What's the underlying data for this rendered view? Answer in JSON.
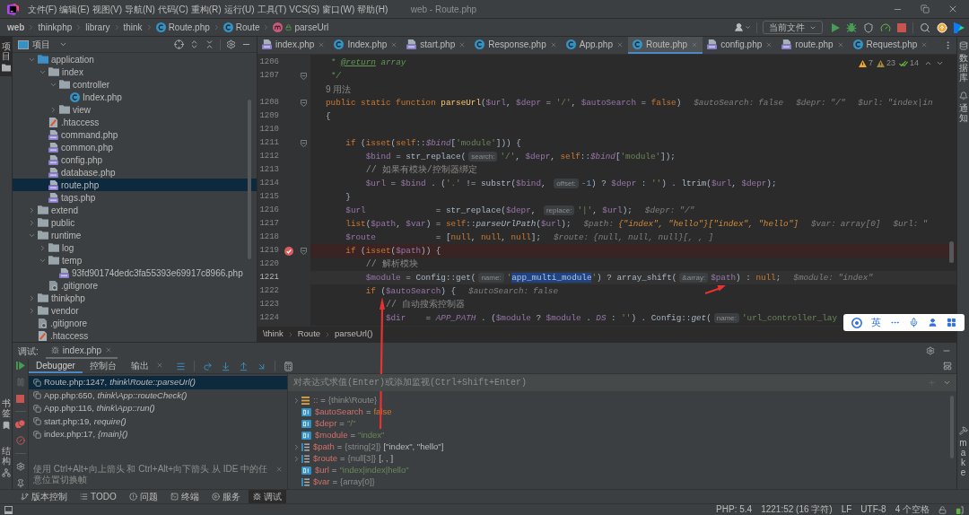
{
  "title_bar": {
    "menu": [
      "文件(F)",
      "编辑(E)",
      "视图(V)",
      "导航(N)",
      "代码(C)",
      "重构(R)",
      "运行(U)",
      "工具(T)",
      "VCS(S)",
      "窗口(W)",
      "帮助(H)"
    ],
    "title": "web - Route.php"
  },
  "nav_bar": {
    "breadcrumbs": [
      {
        "label": "web",
        "kind": "project"
      },
      {
        "label": "thinkphp",
        "kind": "folder"
      },
      {
        "label": "library",
        "kind": "folder"
      },
      {
        "label": "think",
        "kind": "folder"
      },
      {
        "label": "Route.php",
        "kind": "class"
      },
      {
        "label": "Route",
        "kind": "class"
      },
      {
        "label": "parseUrl",
        "kind": "method"
      }
    ],
    "run_configuration": "当前文件"
  },
  "left_stripe": {
    "top": [
      {
        "label": "项目",
        "kind": "project",
        "selected": true
      }
    ],
    "bottom": [
      {
        "label": "书签",
        "kind": "bookmarks",
        "selected": false
      },
      {
        "label": "结构",
        "kind": "structure",
        "selected": false
      }
    ]
  },
  "right_stripe": {
    "top": [
      {
        "label": "数据库",
        "kind": "database",
        "selected": false
      },
      {
        "label": "通知",
        "kind": "notifications",
        "selected": false
      }
    ],
    "bottom": [
      {
        "label": "make",
        "kind": "make",
        "selected": false
      }
    ]
  },
  "project": {
    "title": "项目",
    "tree": [
      {
        "label": "application",
        "kind": "source_folder",
        "expanded": true,
        "selected": false,
        "children": [
          {
            "label": "index",
            "kind": "folder",
            "expanded": true,
            "selected": false,
            "children": [
              {
                "label": "controller",
                "kind": "folder",
                "expanded": true,
                "selected": false,
                "children": [
                  {
                    "label": "Index.php",
                    "kind": "class",
                    "selected": false
                  }
                ]
              },
              {
                "label": "view",
                "kind": "folder",
                "expanded": false,
                "selected": false
              }
            ]
          },
          {
            "label": ".htaccess",
            "kind": "htaccess",
            "selected": false
          },
          {
            "label": "command.php",
            "kind": "php",
            "selected": false
          },
          {
            "label": "common.php",
            "kind": "php",
            "selected": false
          },
          {
            "label": "config.php",
            "kind": "php",
            "selected": false
          },
          {
            "label": "database.php",
            "kind": "php",
            "selected": false
          },
          {
            "label": "route.php",
            "kind": "php",
            "selected": true
          },
          {
            "label": "tags.php",
            "kind": "php",
            "selected": false
          }
        ]
      },
      {
        "label": "extend",
        "kind": "folder",
        "expanded": false,
        "selected": false
      },
      {
        "label": "public",
        "kind": "folder",
        "expanded": false,
        "selected": false
      },
      {
        "label": "runtime",
        "kind": "folder",
        "expanded": true,
        "selected": false,
        "children": [
          {
            "label": "log",
            "kind": "folder",
            "expanded": false,
            "selected": false
          },
          {
            "label": "temp",
            "kind": "folder",
            "expanded": true,
            "selected": false,
            "children": [
              {
                "label": "93fd90174dedc3fa55393e69917c8966.php",
                "kind": "php",
                "selected": false
              }
            ]
          },
          {
            "label": ".gitignore",
            "kind": "gitignore",
            "selected": false
          }
        ]
      },
      {
        "label": "thinkphp",
        "kind": "folder",
        "expanded": false,
        "selected": false
      },
      {
        "label": "vendor",
        "kind": "folder",
        "expanded": false,
        "selected": false
      },
      {
        "label": ".gitignore",
        "kind": "gitignore",
        "selected": false
      },
      {
        "label": ".htaccess",
        "kind": "htaccess",
        "selected": false
      }
    ]
  },
  "editor": {
    "tabs": [
      {
        "label": "index.php",
        "kind": "php",
        "selected": false
      },
      {
        "label": "Index.php",
        "kind": "class",
        "selected": false
      },
      {
        "label": "start.php",
        "kind": "php",
        "selected": false
      },
      {
        "label": "Response.php",
        "kind": "class",
        "selected": false
      },
      {
        "label": "App.php",
        "kind": "class",
        "selected": false
      },
      {
        "label": "Route.php",
        "kind": "class",
        "selected": true
      },
      {
        "label": "config.php",
        "kind": "php",
        "selected": false
      },
      {
        "label": "route.php",
        "kind": "php",
        "selected": false
      },
      {
        "label": "Request.php",
        "kind": "class",
        "selected": false
      }
    ],
    "inspections": [
      {
        "kind": "warning",
        "count": "7"
      },
      {
        "kind": "weak_warning",
        "count": "23"
      },
      {
        "kind": "typo",
        "count": "14"
      }
    ],
    "lines": [
      {
        "kind": "code",
        "number": "1206",
        "current": false,
        "breakpoint": false,
        "fold": false,
        "segments": [
          {
            "kind": "doc",
            "text": " * "
          },
          {
            "kind": "doctag",
            "text": "@return"
          },
          {
            "kind": "doc",
            "text": " array"
          }
        ]
      },
      {
        "kind": "code",
        "number": "1207",
        "current": false,
        "breakpoint": false,
        "fold": true,
        "segments": [
          {
            "kind": "doc",
            "text": " */"
          }
        ]
      },
      {
        "kind": "usages",
        "text": "9 用法",
        "current": false,
        "breakpoint": false,
        "fold": false
      },
      {
        "kind": "code",
        "number": "1208",
        "current": false,
        "breakpoint": false,
        "fold": true,
        "segments": [
          {
            "kind": "keyword",
            "text": "public static function "
          },
          {
            "kind": "function",
            "text": "parseUrl"
          },
          {
            "kind": "plain",
            "text": "("
          },
          {
            "kind": "variable",
            "text": "$url"
          },
          {
            "kind": "plain",
            "text": ", "
          },
          {
            "kind": "variable",
            "text": "$depr"
          },
          {
            "kind": "plain",
            "text": " = "
          },
          {
            "kind": "string",
            "text": "'/'"
          },
          {
            "kind": "plain",
            "text": ", "
          },
          {
            "kind": "variable",
            "text": "$autoSearch"
          },
          {
            "kind": "plain",
            "text": " = "
          },
          {
            "kind": "keyword",
            "text": "false"
          },
          {
            "kind": "plain",
            "text": ")"
          },
          {
            "kind": "debug",
            "name": "$autoSearch:",
            "value": "false",
            "changed": false
          },
          {
            "kind": "debug",
            "name": "$depr:",
            "value": "\"/\"",
            "changed": false
          },
          {
            "kind": "debug",
            "name": "$url:",
            "value": "\"index|in",
            "changed": false
          }
        ]
      },
      {
        "kind": "code",
        "number": "1209",
        "current": false,
        "breakpoint": false,
        "fold": false,
        "segments": [
          {
            "kind": "plain",
            "text": "{"
          }
        ]
      },
      {
        "kind": "code",
        "number": "1210",
        "current": false,
        "breakpoint": false,
        "fold": false
      },
      {
        "kind": "code",
        "number": "1211",
        "current": false,
        "breakpoint": false,
        "fold": true,
        "segments": [
          {
            "kind": "keyword",
            "text": "    if"
          },
          {
            "kind": "plain",
            "text": " ("
          },
          {
            "kind": "keyword",
            "text": "isset"
          },
          {
            "kind": "plain",
            "text": "("
          },
          {
            "kind": "keyword",
            "text": "self"
          },
          {
            "kind": "plain",
            "text": "::"
          },
          {
            "kind": "field",
            "text": "$bind"
          },
          {
            "kind": "plain",
            "text": "["
          },
          {
            "kind": "string",
            "text": "'module'"
          },
          {
            "kind": "plain",
            "text": "])) {"
          }
        ]
      },
      {
        "kind": "code",
        "number": "1212",
        "current": false,
        "breakpoint": false,
        "fold": false,
        "segments": [
          {
            "kind": "variable",
            "text": "        $bind"
          },
          {
            "kind": "plain",
            "text": " = str_replace("
          },
          {
            "kind": "hint",
            "text": "search:"
          },
          {
            "kind": "string",
            "text": "'/'"
          },
          {
            "kind": "plain",
            "text": ", "
          },
          {
            "kind": "variable",
            "text": "$depr"
          },
          {
            "kind": "plain",
            "text": ", "
          },
          {
            "kind": "keyword",
            "text": "self"
          },
          {
            "kind": "plain",
            "text": "::"
          },
          {
            "kind": "field",
            "text": "$bind"
          },
          {
            "kind": "plain",
            "text": "["
          },
          {
            "kind": "string",
            "text": "'module'"
          },
          {
            "kind": "plain",
            "text": "]);"
          }
        ]
      },
      {
        "kind": "code",
        "number": "1213",
        "current": false,
        "breakpoint": false,
        "fold": false,
        "segments": [
          {
            "kind": "comment",
            "text": "        // 如果有模块/控制器绑定"
          }
        ]
      },
      {
        "kind": "code",
        "number": "1214",
        "current": false,
        "breakpoint": false,
        "fold": false,
        "segments": [
          {
            "kind": "variable",
            "text": "        $url"
          },
          {
            "kind": "plain",
            "text": " = "
          },
          {
            "kind": "variable",
            "text": "$bind"
          },
          {
            "kind": "plain",
            "text": " . ("
          },
          {
            "kind": "string",
            "text": "'.'"
          },
          {
            "kind": "plain",
            "text": " != substr("
          },
          {
            "kind": "variable",
            "text": "$bind"
          },
          {
            "kind": "plain",
            "text": ", "
          },
          {
            "kind": "hint",
            "text": "offset:"
          },
          {
            "kind": "number",
            "text": "-1"
          },
          {
            "kind": "plain",
            "text": ") ? "
          },
          {
            "kind": "variable",
            "text": "$depr"
          },
          {
            "kind": "plain",
            "text": " : "
          },
          {
            "kind": "string",
            "text": "''"
          },
          {
            "kind": "plain",
            "text": ") . ltrim("
          },
          {
            "kind": "variable",
            "text": "$url"
          },
          {
            "kind": "plain",
            "text": ", "
          },
          {
            "kind": "variable",
            "text": "$depr"
          },
          {
            "kind": "plain",
            "text": ");"
          }
        ]
      },
      {
        "kind": "code",
        "number": "1215",
        "current": false,
        "breakpoint": false,
        "fold": false,
        "segments": [
          {
            "kind": "plain",
            "text": "    }"
          }
        ]
      },
      {
        "kind": "code",
        "number": "1216",
        "current": false,
        "breakpoint": false,
        "fold": false,
        "segments": [
          {
            "kind": "variable",
            "text": "    $url"
          },
          {
            "kind": "plain",
            "text": "              = str_replace("
          },
          {
            "kind": "variable",
            "text": "$depr"
          },
          {
            "kind": "plain",
            "text": ", "
          },
          {
            "kind": "hint",
            "text": "replace:"
          },
          {
            "kind": "string",
            "text": "'|'"
          },
          {
            "kind": "plain",
            "text": ", "
          },
          {
            "kind": "variable",
            "text": "$url"
          },
          {
            "kind": "plain",
            "text": ");"
          },
          {
            "kind": "debug",
            "name": "$depr:",
            "value": "\"/\"",
            "changed": false
          }
        ]
      },
      {
        "kind": "code",
        "number": "1217",
        "current": false,
        "breakpoint": false,
        "fold": false,
        "segments": [
          {
            "kind": "keyword",
            "text": "    list"
          },
          {
            "kind": "plain",
            "text": "("
          },
          {
            "kind": "variable",
            "text": "$path"
          },
          {
            "kind": "plain",
            "text": ", "
          },
          {
            "kind": "variable",
            "text": "$var"
          },
          {
            "kind": "plain",
            "text": ") = "
          },
          {
            "kind": "keyword",
            "text": "self"
          },
          {
            "kind": "plain",
            "text": "::"
          },
          {
            "kind": "static",
            "text": "parseUrlPath"
          },
          {
            "kind": "plain",
            "text": "("
          },
          {
            "kind": "variable",
            "text": "$url"
          },
          {
            "kind": "plain",
            "text": ");"
          },
          {
            "kind": "debug",
            "name": "$path:",
            "value": "{\"index\", \"hello\"}[\"index\", \"hello\"]",
            "changed": true
          },
          {
            "kind": "debug",
            "name": "$var:",
            "value": "array[0]",
            "changed": false
          },
          {
            "kind": "debug",
            "name": "$url:",
            "value": "\"",
            "changed": false
          }
        ]
      },
      {
        "kind": "code",
        "number": "1218",
        "current": false,
        "breakpoint": false,
        "fold": false,
        "segments": [
          {
            "kind": "variable",
            "text": "    $route"
          },
          {
            "kind": "plain",
            "text": "            = ["
          },
          {
            "kind": "keyword",
            "text": "null"
          },
          {
            "kind": "plain",
            "text": ", "
          },
          {
            "kind": "keyword",
            "text": "null"
          },
          {
            "kind": "plain",
            "text": ", "
          },
          {
            "kind": "keyword",
            "text": "null"
          },
          {
            "kind": "plain",
            "text": "];"
          },
          {
            "kind": "debug",
            "name": "$route:",
            "value": "{null, null, null}[, , ]",
            "changed": false
          }
        ]
      },
      {
        "kind": "code",
        "number": "1219",
        "current": false,
        "breakpoint": true,
        "fold": true,
        "segments": [
          {
            "kind": "keyword",
            "text": "    if"
          },
          {
            "kind": "plain",
            "text": " ("
          },
          {
            "kind": "keyword",
            "text": "isset"
          },
          {
            "kind": "plain",
            "text": "("
          },
          {
            "kind": "variable",
            "text": "$path"
          },
          {
            "kind": "plain",
            "text": ")) {"
          }
        ]
      },
      {
        "kind": "code",
        "number": "1220",
        "current": false,
        "breakpoint": false,
        "fold": false,
        "segments": [
          {
            "kind": "comment",
            "text": "        // 解析模块"
          }
        ]
      },
      {
        "kind": "code",
        "number": "1221",
        "current": true,
        "breakpoint": false,
        "fold": false,
        "segments": [
          {
            "kind": "variable",
            "text": "        $module"
          },
          {
            "kind": "plain",
            "text": " = Config::get("
          },
          {
            "kind": "hint",
            "text": "name:"
          },
          {
            "kind": "string",
            "text": "'"
          },
          {
            "kind": "selection",
            "text": "app_multi_module"
          },
          {
            "kind": "string",
            "text": "'"
          },
          {
            "kind": "plain",
            "text": ") ? array_shift("
          },
          {
            "kind": "hint",
            "text": "&array:"
          },
          {
            "kind": "variable",
            "text": "$path"
          },
          {
            "kind": "plain",
            "text": ") : "
          },
          {
            "kind": "keyword",
            "text": "null"
          },
          {
            "kind": "plain",
            "text": ";"
          },
          {
            "kind": "debug",
            "name": "$module:",
            "value": "\"index\"",
            "changed": false
          }
        ]
      },
      {
        "kind": "code",
        "number": "1222",
        "current": false,
        "breakpoint": false,
        "fold": false,
        "segments": [
          {
            "kind": "keyword",
            "text": "        if"
          },
          {
            "kind": "plain",
            "text": " ("
          },
          {
            "kind": "variable",
            "text": "$autoSearch"
          },
          {
            "kind": "plain",
            "text": ") {"
          },
          {
            "kind": "debug",
            "name": "$autoSearch:",
            "value": "false",
            "changed": false
          }
        ]
      },
      {
        "kind": "code",
        "number": "1223",
        "current": false,
        "breakpoint": false,
        "fold": false,
        "segments": [
          {
            "kind": "comment",
            "text": "            // 自动搜索控制器"
          }
        ]
      },
      {
        "kind": "code",
        "number": "1224",
        "current": false,
        "breakpoint": false,
        "fold": false,
        "segments": [
          {
            "kind": "variable",
            "text": "            $dir"
          },
          {
            "kind": "plain",
            "text": "    = "
          },
          {
            "kind": "constant",
            "text": "APP_PATH"
          },
          {
            "kind": "plain",
            "text": " . ("
          },
          {
            "kind": "variable",
            "text": "$module"
          },
          {
            "kind": "plain",
            "text": " ? "
          },
          {
            "kind": "variable",
            "text": "$module"
          },
          {
            "kind": "plain",
            "text": " . "
          },
          {
            "kind": "constant",
            "text": "DS"
          },
          {
            "kind": "plain",
            "text": " : "
          },
          {
            "kind": "string",
            "text": "''"
          },
          {
            "kind": "plain",
            "text": ") . Config::"
          },
          {
            "kind": "static",
            "text": "get"
          },
          {
            "kind": "plain",
            "text": "("
          },
          {
            "kind": "hint",
            "text": "name:"
          },
          {
            "kind": "string",
            "text": "'url_controller_lay"
          }
        ]
      }
    ],
    "breadcrumbs": [
      "\\think",
      "Route",
      "parseUrl()"
    ]
  },
  "input_method_bar": {
    "label": "英"
  },
  "debug": {
    "label": "调试:",
    "session": "index.php",
    "tabs": [
      {
        "label": "Debugger",
        "selected": true,
        "closable": false
      },
      {
        "label": "控制台",
        "selected": false,
        "closable": false
      },
      {
        "label": "输出",
        "selected": false,
        "closable": true
      }
    ],
    "frames": [
      {
        "file": "Route.php:1247,",
        "method": "think\\Route::parseUrl()",
        "selected": true
      },
      {
        "file": "App.php:650,",
        "method": "think\\App::routeCheck()",
        "selected": false
      },
      {
        "file": "App.php:116,",
        "method": "think\\App::run()",
        "selected": false
      },
      {
        "file": "start.php:19,",
        "method": "require()",
        "selected": false
      },
      {
        "file": "index.php:17,",
        "method": "{main}()",
        "selected": false
      }
    ],
    "frames_hint": "使用 Ctrl+Alt+向上箭头 和 Ctrl+Alt+向下箭头 从 IDE 中的任意位置切换帧",
    "watch_placeholder": "对表达式求值(Enter)或添加监视(Ctrl+Shift+Enter)",
    "variables": [
      {
        "name": "::",
        "op": "=",
        "type": "{think\\Route}",
        "kind": "static",
        "expanded": false
      },
      {
        "name": "$autoSearch",
        "op": "=",
        "value": {
          "text": "false",
          "kind": "keyword"
        },
        "kind": "scalar"
      },
      {
        "name": "$depr",
        "op": "=",
        "value": {
          "text": "\"/\"",
          "kind": "string"
        },
        "kind": "scalar"
      },
      {
        "name": "$module",
        "op": "=",
        "value": {
          "text": "\"index\"",
          "kind": "string"
        },
        "kind": "scalar"
      },
      {
        "name": "$path",
        "op": "=",
        "type": "{string[2]}",
        "value": {
          "text": "[\"index\", \"hello\"]",
          "kind": "plain"
        },
        "kind": "array",
        "expanded": false
      },
      {
        "name": "$route",
        "op": "=",
        "type": "{null[3]}",
        "value": {
          "text": "[, , ]",
          "kind": "plain"
        },
        "kind": "array",
        "expanded": false
      },
      {
        "name": "$url",
        "op": "=",
        "value": {
          "text": "\"index|index|hello\"",
          "kind": "string"
        },
        "kind": "scalar"
      },
      {
        "name": "$var",
        "op": "=",
        "type": "{array[0]}",
        "kind": "array"
      }
    ]
  },
  "tool_windows": [
    {
      "label": "版本控制",
      "kind": "vcs",
      "selected": false
    },
    {
      "label": "TODO",
      "kind": "todo",
      "selected": false
    },
    {
      "label": "问题",
      "kind": "problems",
      "selected": false
    },
    {
      "label": "终端",
      "kind": "terminal",
      "selected": false
    },
    {
      "label": "服务",
      "kind": "services",
      "selected": false
    },
    {
      "label": "调试",
      "kind": "debug",
      "selected": true
    }
  ],
  "status_bar": {
    "items": [
      "PHP: 5.4",
      "1221:52 (16 字符)",
      "LF",
      "UTF-8",
      "4 个空格"
    ]
  }
}
